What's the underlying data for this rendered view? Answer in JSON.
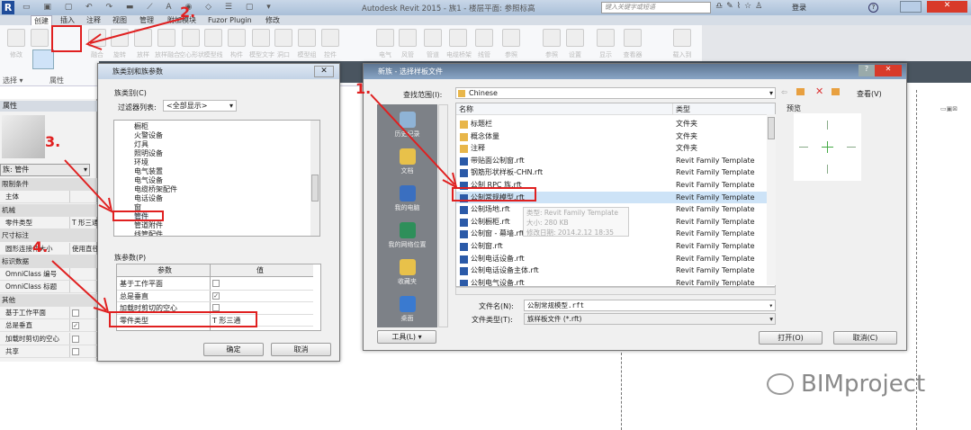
{
  "titlebar": {
    "title": "Autodesk Revit 2015 -   族1 - 楼层平面: 参照标高",
    "search_placeholder": "键入关键字或短语",
    "login": "登录"
  },
  "tabs": [
    "创建",
    "插入",
    "注释",
    "视图",
    "管理",
    "附加模块",
    "Fuzor Plugin",
    "修改"
  ],
  "ribbon": {
    "buttons": [
      "修改",
      "拉伸",
      "融合",
      "旋转",
      "放样",
      "放样融合",
      "空心形状",
      "模型线",
      "构件",
      "模型文字",
      "洞口",
      "模型组",
      "控件",
      "电气",
      "风管",
      "管道",
      "电缆桥架",
      "线管",
      "参照",
      "参照",
      "设置",
      "显示",
      "查看器",
      "载入到"
    ],
    "panels": [
      "选择 ▾",
      "属性"
    ]
  },
  "properties": {
    "header": "属性",
    "type_selector": "族: 管件",
    "rows": [
      {
        "group": "限制条件"
      },
      {
        "key": "主体",
        "value": ""
      },
      {
        "group": "机械"
      },
      {
        "key": "零件类型",
        "value": "T 形三通"
      },
      {
        "group": "尺寸标注"
      },
      {
        "key": "圆形连接件大小",
        "value": "使用直径"
      },
      {
        "group": "标识数据"
      },
      {
        "key": "OmniClass 编号",
        "value": ""
      },
      {
        "key": "OmniClass 标题",
        "value": ""
      },
      {
        "group": "其他"
      },
      {
        "key": "基于工作平面",
        "check": false
      },
      {
        "key": "总是垂直",
        "check": true
      },
      {
        "key": "加载时剪切的空心",
        "check": false
      },
      {
        "key": "共享",
        "check": false
      }
    ]
  },
  "family_dialog": {
    "title": "族类别和族参数",
    "category_label": "族类别(C)",
    "filter_label": "过滤器列表:",
    "filter_value": "<全部显示>",
    "categories": [
      "橱柜",
      "火警设备",
      "灯具",
      "照明设备",
      "环境",
      "电气装置",
      "电气设备",
      "电缆桥架配件",
      "电话设备",
      "窗",
      "管件",
      "管道附件",
      "线管配件"
    ],
    "selected_category": "管件",
    "params_label": "族参数(P)",
    "param_headers": [
      "参数",
      "值"
    ],
    "params": [
      {
        "name": "基于工作平面",
        "check": false
      },
      {
        "name": "总是垂直",
        "check": true
      },
      {
        "name": "加载时剪切的空心",
        "check": false
      },
      {
        "name": "零件类型",
        "value": "T 形三通"
      }
    ],
    "ok": "确定",
    "cancel": "取消"
  },
  "template_dialog": {
    "title": "新族 - 选择样板文件",
    "lookin_label": "查找范围(I):",
    "lookin_value": "Chinese",
    "view_label": "查看(V)",
    "sidebar": [
      "历史记录",
      "文档",
      "我的电脑",
      "我的网络位置",
      "收藏夹",
      "桌面"
    ],
    "headers": [
      "名称",
      "类型"
    ],
    "files": [
      {
        "name": "标题栏",
        "type": "文件夹",
        "folder": true
      },
      {
        "name": "概念体量",
        "type": "文件夹",
        "folder": true
      },
      {
        "name": "注释",
        "type": "文件夹",
        "folder": true
      },
      {
        "name": "带贴面公制窗.rft",
        "type": "Revit Family Template"
      },
      {
        "name": "钢筋形状样板-CHN.rft",
        "type": "Revit Family Template"
      },
      {
        "name": "公制 RPC 族.rft",
        "type": "Revit Family Template"
      },
      {
        "name": "公制常规模型.rft",
        "type": "Revit Family Template",
        "selected": true
      },
      {
        "name": "公制场地.rft",
        "type": "Revit Family Template"
      },
      {
        "name": "公制橱柜.rft",
        "type": "Revit Family Template"
      },
      {
        "name": "公制窗 - 幕墙.rft",
        "type": "Revit Family Template"
      },
      {
        "name": "公制窗.rft",
        "type": "Revit Family Template"
      },
      {
        "name": "公制电话设备.rft",
        "type": "Revit Family Template"
      },
      {
        "name": "公制电话设备主体.rft",
        "type": "Revit Family Template"
      },
      {
        "name": "公制电气设备.rft",
        "type": "Revit Family Template"
      }
    ],
    "tooltip": [
      "类型: Revit Family Template",
      "大小: 280 KB",
      "修改日期: 2014.2.12 18:35"
    ],
    "preview_label": "预览",
    "filename_label": "文件名(N):",
    "filename_value": "公制常规模型.rft",
    "filetype_label": "文件类型(T):",
    "filetype_value": "族样板文件 (*.rft)",
    "tools": "工具(L)",
    "open": "打开(O)",
    "cancel": "取消(C)"
  },
  "annotations": [
    "1.",
    "2.",
    "3.",
    "4."
  ],
  "watermark": "BIMproject",
  "colors": {
    "annotation": "#e02020",
    "selection": "#cde3f7"
  }
}
